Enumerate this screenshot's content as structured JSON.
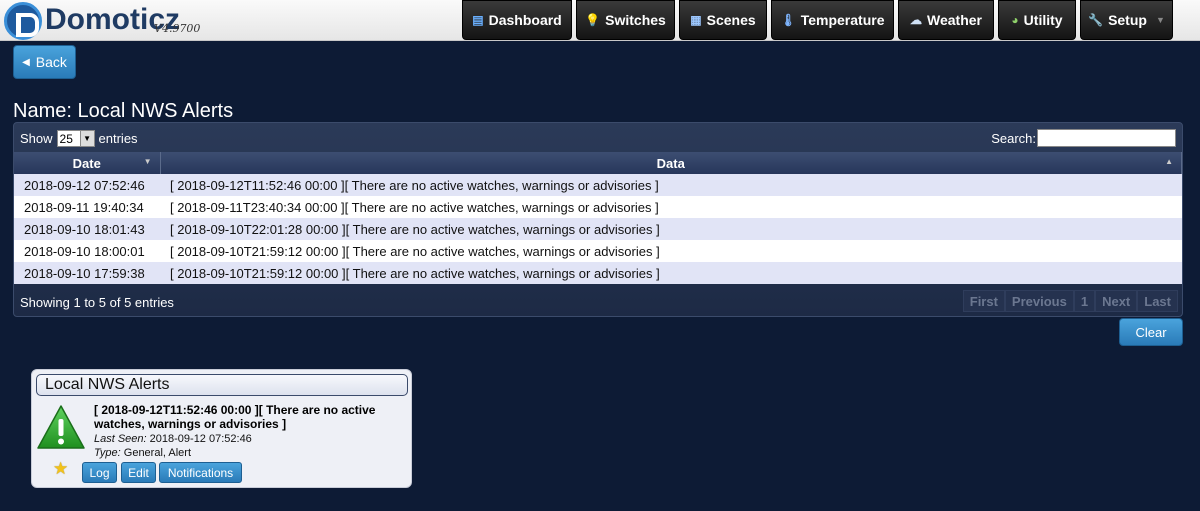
{
  "app": {
    "brand": "Domoticz",
    "version": "V4.9700"
  },
  "nav": [
    {
      "label": "Dashboard",
      "icon": "dashboard-icon"
    },
    {
      "label": "Switches",
      "icon": "lightbulb-icon"
    },
    {
      "label": "Scenes",
      "icon": "clapperboard-icon"
    },
    {
      "label": "Temperature",
      "icon": "thermometer-icon"
    },
    {
      "label": "Weather",
      "icon": "cloud-rain-icon"
    },
    {
      "label": "Utility",
      "icon": "gauge-icon"
    },
    {
      "label": "Setup",
      "icon": "wrench-icon"
    }
  ],
  "back_label": "Back",
  "page": {
    "title": "Name: Local NWS Alerts"
  },
  "table": {
    "show_label": "Show",
    "entries_value": "25",
    "entries_label": "entries",
    "search_label": "Search:",
    "search_value": "",
    "columns": [
      "Date",
      "Data"
    ],
    "rows": [
      {
        "date": "2018-09-12 07:52:46",
        "data": "[ 2018-09-12T11:52:46 00:00 ][ There are no active watches, warnings or advisories ]"
      },
      {
        "date": "2018-09-11 19:40:34",
        "data": "[ 2018-09-11T23:40:34 00:00 ][ There are no active watches, warnings or advisories ]"
      },
      {
        "date": "2018-09-10 18:01:43",
        "data": "[ 2018-09-10T22:01:28 00:00 ][ There are no active watches, warnings or advisories ]"
      },
      {
        "date": "2018-09-10 18:00:01",
        "data": "[ 2018-09-10T21:59:12 00:00 ][ There are no active watches, warnings or advisories ]"
      },
      {
        "date": "2018-09-10 17:59:38",
        "data": "[ 2018-09-10T21:59:12 00:00 ][ There are no active watches, warnings or advisories ]"
      }
    ],
    "info": "Showing 1 to 5 of 5 entries",
    "pager": {
      "first": "First",
      "previous": "Previous",
      "page": "1",
      "next": "Next",
      "last": "Last"
    }
  },
  "clear_label": "Clear",
  "device": {
    "title": "Local NWS Alerts",
    "data": "[ 2018-09-12T11:52:46 00:00 ][ There are no active watches, warnings or advisories ]",
    "last_seen_label": "Last Seen:",
    "last_seen_value": "2018-09-12 07:52:46",
    "type_label": "Type:",
    "type_value": "General, Alert",
    "buttons": {
      "log": "Log",
      "edit": "Edit",
      "notifications": "Notifications"
    },
    "status_color": "#2fa12f"
  },
  "colors": {
    "accent": "#2a7bb8",
    "background": "#0d1b35"
  }
}
